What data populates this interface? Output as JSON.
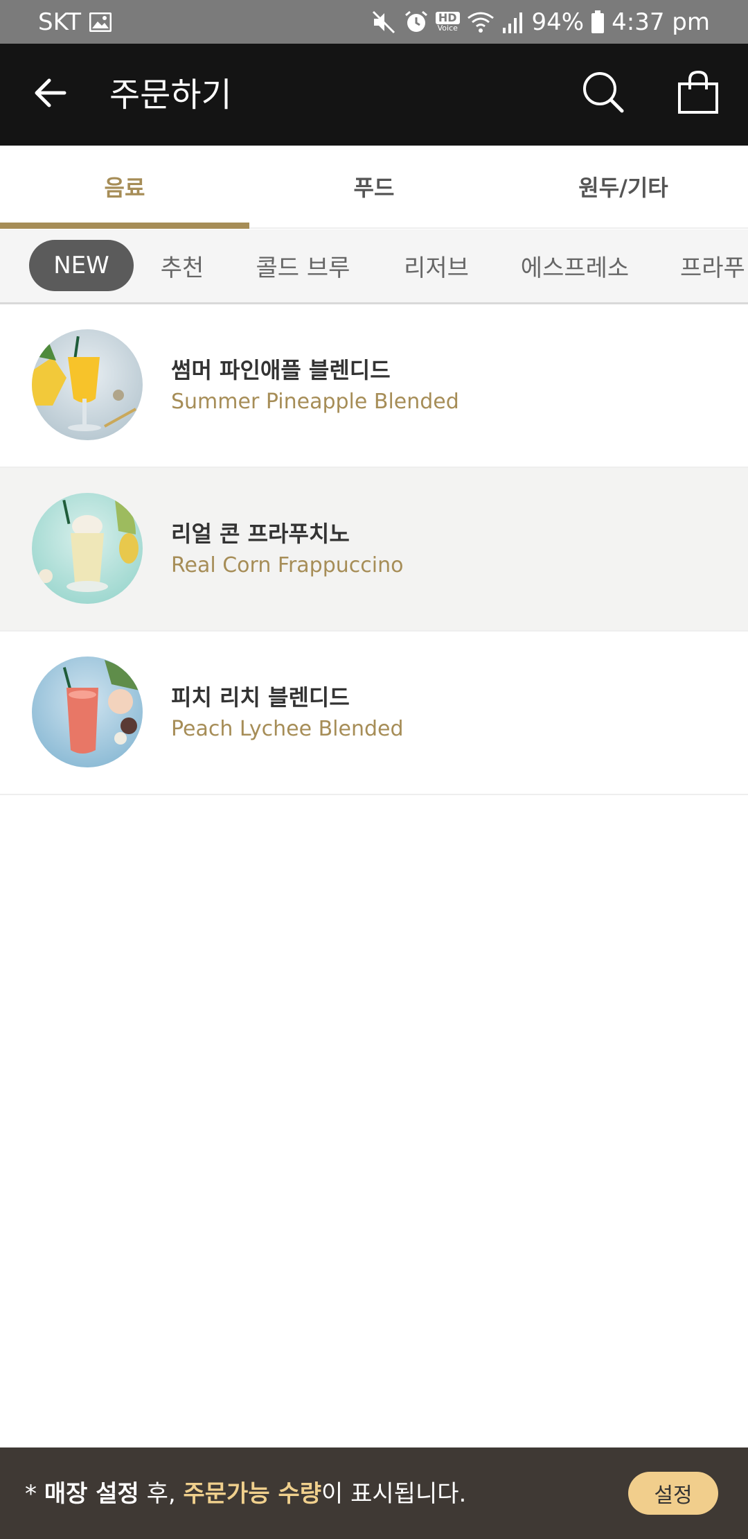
{
  "status_bar": {
    "carrier": "SKT",
    "hd_label": "HD",
    "voice_label": "Voice",
    "battery": "94%",
    "time": "4:37 pm"
  },
  "header": {
    "title": "주문하기"
  },
  "main_tabs": [
    {
      "label": "음료",
      "active": true
    },
    {
      "label": "푸드",
      "active": false
    },
    {
      "label": "원두/기타",
      "active": false
    }
  ],
  "categories": [
    {
      "label": "NEW",
      "active": true
    },
    {
      "label": "추천"
    },
    {
      "label": "콜드 브루"
    },
    {
      "label": "리저브"
    },
    {
      "label": "에스프레소"
    },
    {
      "label": "프라푸"
    }
  ],
  "products": [
    {
      "name_ko": "썸머 파인애플 블렌디드",
      "name_en": "Summer Pineapple Blended"
    },
    {
      "name_ko": "리얼 콘 프라푸치노",
      "name_en": "Real Corn Frappuccino"
    },
    {
      "name_ko": "피치 리치 블렌디드",
      "name_en": "Peach Lychee Blended"
    }
  ],
  "footer": {
    "prefix": "* ",
    "bold_part": "매장 설정",
    "mid": " 후, ",
    "accent_part": "주문가능 수량",
    "suffix": "이 표시됩니다.",
    "button_label": "설정"
  },
  "colors": {
    "accent_gold": "#a68d57",
    "header_bg": "#141414",
    "footer_bg": "#3f3934",
    "footer_accent": "#f0d08d",
    "button_bg": "#f1ce8c"
  }
}
